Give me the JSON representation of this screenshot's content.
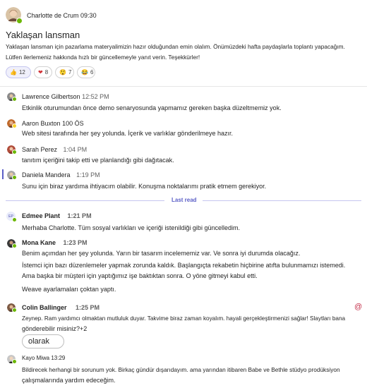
{
  "post": {
    "author": "Charlotte de Crum",
    "time": "09:30",
    "title": "Yaklaşan lansman",
    "body_line1": "Yaklaşan lansman için pazarlama materyalimizin hazır olduğundan emin olalım. Önümüzdeki hafta paydaşlarla toplantı yapacağım.",
    "body_line2": "Lütfen ilerlemeniz hakkında hızlı bir güncellemeyle yanıt verin. Teşekkürler!",
    "reactions": [
      {
        "icon": "thumbs-up-icon",
        "emoji": "👍",
        "count": "12"
      },
      {
        "icon": "heart-icon",
        "emoji": "❤",
        "count": "8"
      },
      {
        "icon": "surprised-icon",
        "emoji": "😲",
        "count": "7"
      },
      {
        "icon": "laugh-icon",
        "emoji": "😂",
        "count": "6"
      }
    ]
  },
  "replies": [
    {
      "name": "Lawrence Gilbertson",
      "time": "12:52 PM",
      "lines": [
        "Etkinlik oturumundan önce demo senaryosunda yapmamız gereken başka düzeltmemiz yok."
      ]
    },
    {
      "name": "Aaron",
      "time": "Buxton 100 ÖS",
      "lines": [
        "Web sitesi tarafında her şey yolunda. İçerik ve varlıklar gönderilmeye hazır."
      ]
    },
    {
      "name": "Sarah Perez",
      "time": "1:04 PM",
      "lines": [
        "tanıtım içeriğini takip etti ve planlandığı gibi dağıtacak."
      ]
    },
    {
      "name": "Daniela Mandera",
      "time": "1:19 PM",
      "lines": [
        "Sunu için biraz yardıma ihtiyacım olabilir. Konuşma noktalarımı pratik etmem gerekiyor."
      ]
    },
    {
      "name": "Edmee Plant",
      "initials": "EP",
      "time": "1:21 PM",
      "lines": [
        "Merhaba Charlotte. Tüm sosyal varlıkları ve içeriği istenildiği gibi güncelledim."
      ]
    },
    {
      "name": "Mona Kane",
      "time": "1:23 PM",
      "lines": [
        "Benim açımdan her şey yolunda. Yarın bir tasarım incelememiz var. Ve sonra iyi durumda olacağız.",
        "İstemci için bazı düzenlemeler yapmak zorunda kaldık. Başlangıçta rekabetin hiçbirine atıfta bulunmamızı istemedi.",
        "Ama başka bir müşteri için yaptığımız işe baktıktan sonra. O yöne gitmeyi kabul etti.",
        "Weave ayarlamaları çoktan yaptı."
      ]
    },
    {
      "name": "Colin Ballinger",
      "time": "1:25 PM",
      "lines": [
        "Zeynep. Ram yardımcı olmaktan mutluluk duyar. Takvime biraz zaman koyalım. hayali gerçekleştirmenizi sağlar! Slaytları bana",
        "gönderebilir misiniz?+2"
      ],
      "pill": "olarak",
      "mention": "@"
    },
    {
      "name": "Kayo Miwa",
      "time": "13:29",
      "lines": [
        "Bildirecek herhangi bir sorunum yok. Birkaç gündür dışarıdayım. ama yarından itibaren Babe ve Bethle stüdyo prodüksiyon",
        "çalışmalarında yardım edeceğim."
      ]
    }
  ],
  "divider": {
    "label": "Last read"
  },
  "colors": {
    "accent": "#5b5fc7",
    "presence": "#6bb700",
    "mention": "#c4314b"
  }
}
